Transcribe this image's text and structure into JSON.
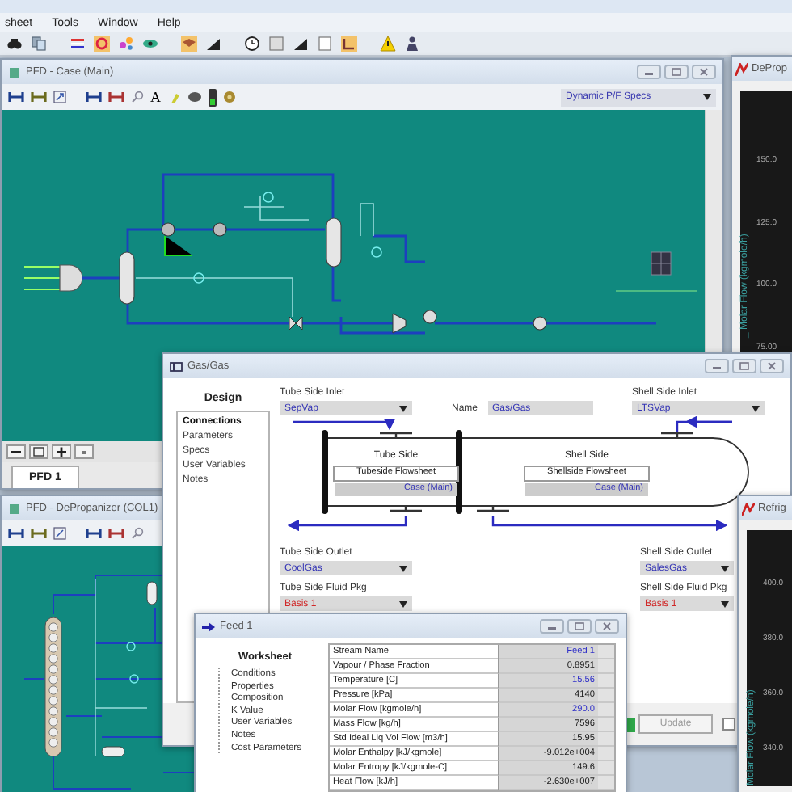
{
  "menu": [
    "sheet",
    "Tools",
    "Window",
    "Help"
  ],
  "pfd_main": {
    "title": "PFD - Case (Main)",
    "font_tool": "A",
    "spec_dropdown": "Dynamic P/F Specs",
    "tabs": [
      {
        "label": "PFD 1",
        "selected": true
      }
    ]
  },
  "strip_chart_deprop": {
    "title": "DeProp",
    "axis_label": "_ Molar Flow (kgmole/h)",
    "ticks": [
      "150.0",
      "125.0",
      "100.0",
      "75.00"
    ]
  },
  "pfd_column": {
    "title": "PFD - DePropanizer (COL1)"
  },
  "exchanger": {
    "title": "Gas/Gas",
    "nav_heading": "Design",
    "nav": [
      {
        "label": "Connections",
        "selected": true
      },
      {
        "label": "Parameters",
        "selected": false
      },
      {
        "label": "Specs",
        "selected": false
      },
      {
        "label": "User Variables",
        "selected": false
      },
      {
        "label": "Notes",
        "selected": false
      }
    ],
    "tube_side_inlet": {
      "label": "Tube Side Inlet",
      "value": "SepVap"
    },
    "name": {
      "label": "Name",
      "value": "Gas/Gas"
    },
    "shell_side_inlet": {
      "label": "Shell Side Inlet",
      "value": "LTSVap"
    },
    "tube_side": {
      "heading": "Tube Side",
      "flowsheet_label": "Tubeside Flowsheet",
      "flowsheet": "Case (Main)"
    },
    "shell_side": {
      "heading": "Shell Side",
      "flowsheet_label": "Shellside Flowsheet",
      "flowsheet": "Case (Main)"
    },
    "tube_side_outlet": {
      "label": "Tube Side Outlet",
      "value": "CoolGas"
    },
    "shell_side_outlet": {
      "label": "Shell Side Outlet",
      "value": "SalesGas"
    },
    "tube_side_fluid_pkg": {
      "label": "Tube Side Fluid Pkg",
      "value": "Basis 1"
    },
    "shell_side_fluid_pkg": {
      "label": "Shell Side Fluid Pkg",
      "value": "Basis 1"
    },
    "update_button": {
      "label": "Update",
      "disabled": true
    },
    "option_checked": false
  },
  "strip_chart_refrig": {
    "title": "Refrig",
    "axis_label": "Molar Flow (kgmole/h)",
    "ticks": [
      "400.0",
      "380.0",
      "360.0",
      "340.0"
    ]
  },
  "feed": {
    "title": "Feed 1",
    "nav_heading": "Worksheet",
    "nav": [
      {
        "label": "Conditions",
        "selected": false
      },
      {
        "label": "Properties",
        "selected": false
      },
      {
        "label": "Composition",
        "selected": false
      },
      {
        "label": "K Value",
        "selected": false
      },
      {
        "label": "User Variables",
        "selected": false
      },
      {
        "label": "Notes",
        "selected": false
      },
      {
        "label": "Cost Parameters",
        "selected": false
      }
    ],
    "rows": [
      {
        "name": "Stream Name",
        "value": "Feed 1",
        "specified": true
      },
      {
        "name": "Vapour / Phase Fraction",
        "value": "0.8951",
        "specified": false
      },
      {
        "name": "Temperature [C]",
        "value": "15.56",
        "specified": true
      },
      {
        "name": "Pressure [kPa]",
        "value": "4140",
        "specified": false
      },
      {
        "name": "Molar Flow [kgmole/h]",
        "value": "290.0",
        "specified": true
      },
      {
        "name": "Mass Flow [kg/h]",
        "value": "7596",
        "specified": false
      },
      {
        "name": "Std Ideal Liq Vol Flow [m3/h]",
        "value": "15.95",
        "specified": false
      },
      {
        "name": "Molar Enthalpy [kJ/kgmole]",
        "value": "-9.012e+004",
        "specified": false
      },
      {
        "name": "Molar Entropy [kJ/kgmole-C]",
        "value": "149.6",
        "specified": false
      },
      {
        "name": "Heat Flow [kJ/h]",
        "value": "-2.630e+007",
        "specified": false
      }
    ]
  }
}
